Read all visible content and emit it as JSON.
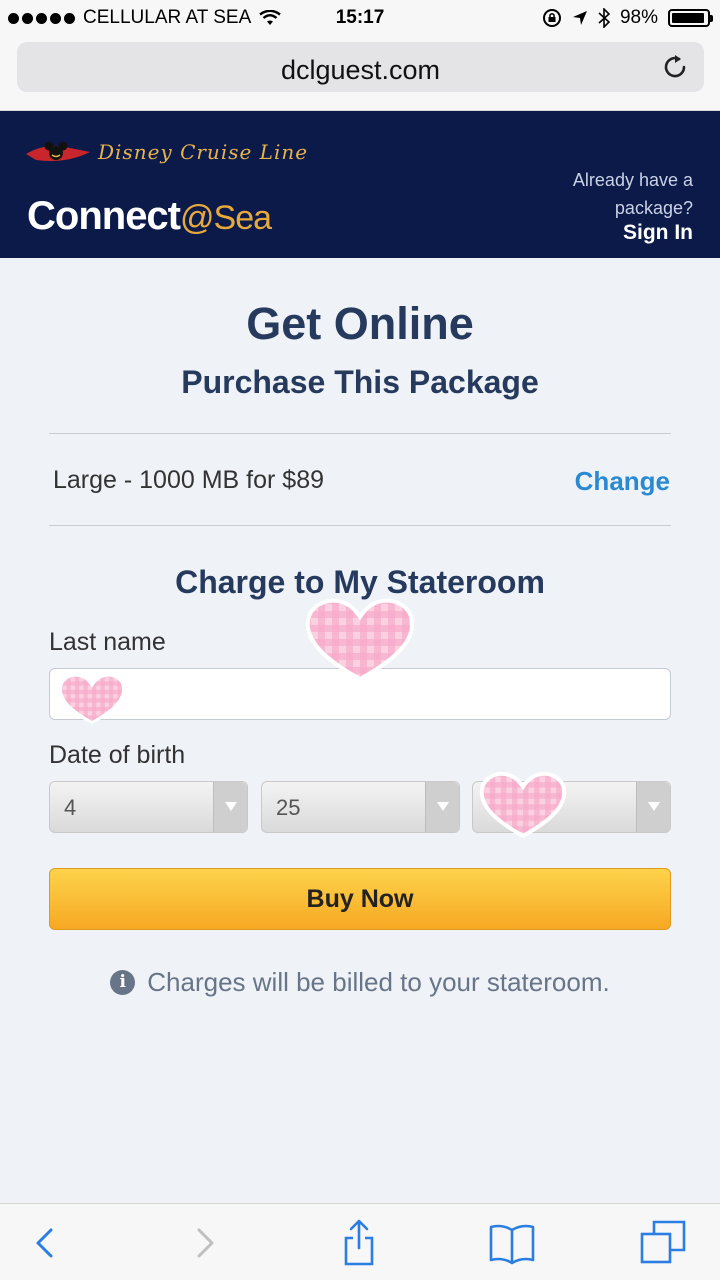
{
  "status_bar": {
    "carrier": "CELLULAR AT SEA",
    "time": "15:17",
    "battery": "98%"
  },
  "browser": {
    "url": "dclguest.com"
  },
  "header": {
    "brand": "Disney Cruise Line",
    "product_name": "Connect",
    "product_suffix": "@Sea",
    "already_text": "Already have a package?",
    "sign_in": "Sign In"
  },
  "main": {
    "title": "Get Online",
    "subtitle": "Purchase This Package",
    "package": "Large - 1000 MB for $89",
    "change_label": "Change",
    "section_title": "Charge to My Stateroom",
    "last_name_label": "Last name",
    "last_name_value": "",
    "dob_label": "Date of birth",
    "dob_month": "4",
    "dob_day": "25",
    "dob_year": "",
    "buy_label": "Buy Now",
    "note": "Charges will be billed to your stateroom."
  },
  "colors": {
    "header_bg": "#0c1a4a",
    "accent_blue": "#2a8ad1",
    "button_yellow": "#f9bb2d",
    "heading_navy": "#263a5e"
  }
}
